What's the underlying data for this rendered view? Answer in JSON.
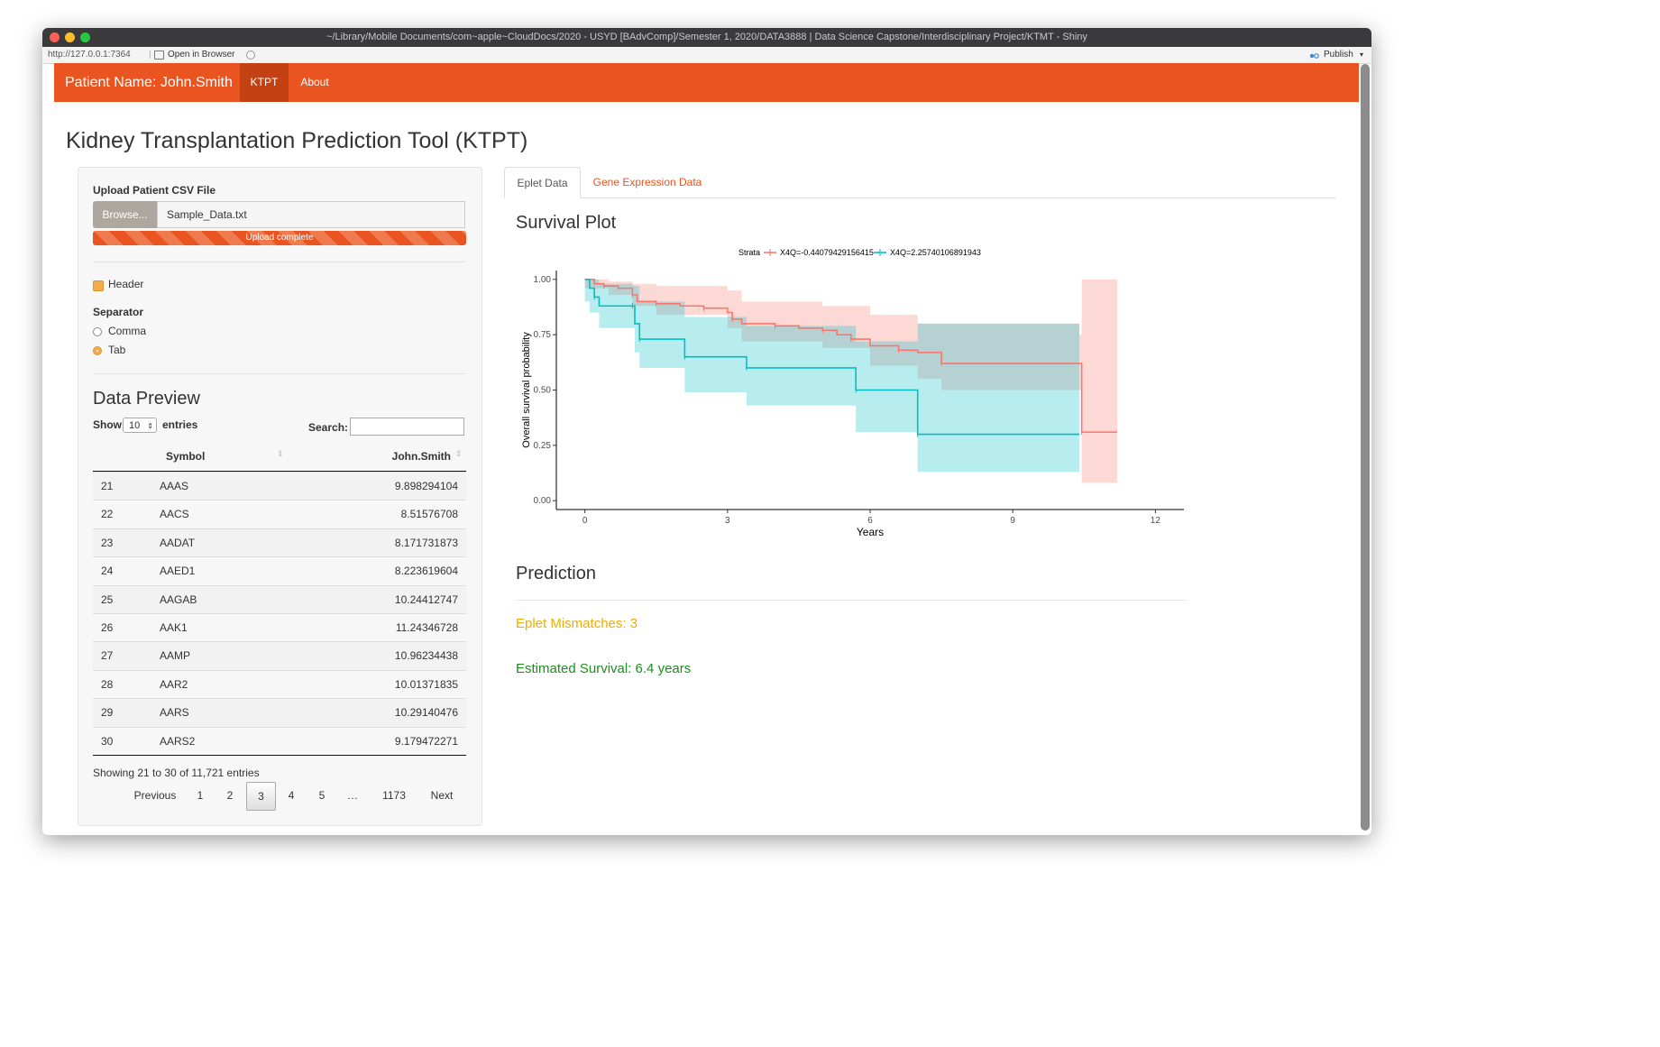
{
  "window": {
    "title": "~/Library/Mobile Documents/com~apple~CloudDocs/2020 - USYD [BAdvComp]/Semester 1, 2020/DATA3888 | Data Science Capstone/Interdisciplinary Project/KTMT - Shiny"
  },
  "toolbar": {
    "url": "http://127.0.0.1:7364",
    "open_in_browser": "Open in Browser",
    "publish": "Publish"
  },
  "nav": {
    "brand": "Patient Name: John.Smith",
    "tabs": [
      "KTPT",
      "About"
    ]
  },
  "page": {
    "title": "Kidney Transplantation Prediction Tool (KTPT)"
  },
  "sidebar": {
    "upload_label": "Upload Patient CSV File",
    "browse_label": "Browse...",
    "file_name": "Sample_Data.txt",
    "progress_text": "Upload complete",
    "upload_progress": 1.0,
    "header_label": "Header",
    "header_checked": true,
    "separator_label": "Separator",
    "separator_options": [
      "Comma",
      "Tab"
    ],
    "separator_selected": "Tab",
    "preview_title": "Data Preview",
    "show_label": "Show",
    "entries_value": "10",
    "entries_label": "entries",
    "search_label": "Search:",
    "columns": [
      "Symbol",
      "John.Smith"
    ],
    "rows": [
      {
        "idx": "21",
        "symbol": "AAAS",
        "value": "9.898294104"
      },
      {
        "idx": "22",
        "symbol": "AACS",
        "value": "8.51576708"
      },
      {
        "idx": "23",
        "symbol": "AADAT",
        "value": "8.171731873"
      },
      {
        "idx": "24",
        "symbol": "AAED1",
        "value": "8.223619604"
      },
      {
        "idx": "25",
        "symbol": "AAGAB",
        "value": "10.24412747"
      },
      {
        "idx": "26",
        "symbol": "AAK1",
        "value": "11.24346728"
      },
      {
        "idx": "27",
        "symbol": "AAMP",
        "value": "10.96234438"
      },
      {
        "idx": "28",
        "symbol": "AAR2",
        "value": "10.01371835"
      },
      {
        "idx": "29",
        "symbol": "AARS",
        "value": "10.29140476"
      },
      {
        "idx": "30",
        "symbol": "AARS2",
        "value": "9.179472271"
      }
    ],
    "info": "Showing 21 to 30 of 11,721 entries",
    "pagination": [
      "Previous",
      "1",
      "2",
      "3",
      "4",
      "5",
      "…",
      "1173",
      "Next"
    ],
    "current_page": "3"
  },
  "main": {
    "tabs": [
      "Eplet Data",
      "Gene Expression Data"
    ],
    "active_tab": "Eplet Data",
    "plot_title": "Survival Plot",
    "prediction_title": "Prediction",
    "eplet_mismatches": "Eplet Mismatches: 3",
    "estimated_survival": "Estimated Survival: 6.4 years"
  },
  "colors": {
    "brand_orange": "#e95420",
    "brand_dark": "#c34113",
    "series_red": "#f8766d",
    "series_teal": "#00bfc4",
    "warning": "#f0ad00",
    "success": "#1e8c1e"
  },
  "chart_data": {
    "type": "line",
    "xlabel": "Years",
    "ylabel": "Overall survival probability",
    "xlim": [
      -0.6,
      12.6
    ],
    "ylim": [
      -0.04,
      1.04
    ],
    "xticks": [
      0,
      3,
      6,
      9,
      12
    ],
    "yticks": [
      0.0,
      0.25,
      0.5,
      0.75,
      1.0
    ],
    "ytick_labels": [
      "0.00",
      "0.25",
      "0.50",
      "0.75",
      "1.00"
    ],
    "legend_title": "Strata",
    "legend_position": "top",
    "grid": false,
    "series": [
      {
        "name": "X4Q=-0.44079429156415",
        "color": "#f8766d",
        "steps": [
          [
            0,
            1.0
          ],
          [
            0.2,
            0.98
          ],
          [
            0.4,
            0.97
          ],
          [
            0.7,
            0.96
          ],
          [
            1.0,
            0.93
          ],
          [
            1.1,
            0.9
          ],
          [
            1.5,
            0.89
          ],
          [
            2.0,
            0.88
          ],
          [
            2.5,
            0.87
          ],
          [
            3.0,
            0.85
          ],
          [
            3.1,
            0.82
          ],
          [
            3.3,
            0.8
          ],
          [
            4.0,
            0.79
          ],
          [
            4.5,
            0.78
          ],
          [
            5.0,
            0.77
          ],
          [
            5.3,
            0.75
          ],
          [
            5.6,
            0.73
          ],
          [
            6.0,
            0.7
          ],
          [
            6.6,
            0.68
          ],
          [
            7.0,
            0.67
          ],
          [
            7.5,
            0.62
          ],
          [
            10.4,
            0.62
          ],
          [
            10.45,
            0.31
          ],
          [
            11.2,
            0.31
          ]
        ],
        "ci_upper": [
          [
            0,
            1.0
          ],
          [
            0.5,
            0.99
          ],
          [
            1.0,
            0.98
          ],
          [
            1.5,
            0.97
          ],
          [
            3.0,
            0.95
          ],
          [
            3.3,
            0.9
          ],
          [
            5.0,
            0.88
          ],
          [
            6.0,
            0.84
          ],
          [
            7.0,
            0.8
          ],
          [
            10.4,
            0.75
          ],
          [
            10.45,
            1.0
          ],
          [
            11.2,
            1.0
          ]
        ],
        "ci_lower": [
          [
            0,
            0.96
          ],
          [
            0.5,
            0.93
          ],
          [
            1.0,
            0.88
          ],
          [
            1.5,
            0.84
          ],
          [
            3.0,
            0.78
          ],
          [
            3.3,
            0.72
          ],
          [
            5.0,
            0.69
          ],
          [
            6.0,
            0.61
          ],
          [
            7.0,
            0.55
          ],
          [
            7.5,
            0.5
          ],
          [
            10.4,
            0.5
          ],
          [
            10.45,
            0.08
          ],
          [
            11.2,
            0.08
          ]
        ]
      },
      {
        "name": "X4Q=2.25740106891943",
        "color": "#00bfc4",
        "steps": [
          [
            0,
            1.0
          ],
          [
            0.1,
            0.96
          ],
          [
            0.2,
            0.92
          ],
          [
            0.3,
            0.88
          ],
          [
            1.0,
            0.88
          ],
          [
            1.05,
            0.8
          ],
          [
            1.15,
            0.73
          ],
          [
            2.0,
            0.73
          ],
          [
            2.1,
            0.65
          ],
          [
            3.3,
            0.65
          ],
          [
            3.4,
            0.6
          ],
          [
            5.6,
            0.6
          ],
          [
            5.7,
            0.5
          ],
          [
            6.9,
            0.5
          ],
          [
            7.0,
            0.3
          ],
          [
            10.4,
            0.3
          ]
        ],
        "ci_upper": [
          [
            0,
            1.0
          ],
          [
            0.3,
            0.98
          ],
          [
            1.0,
            0.97
          ],
          [
            1.15,
            0.9
          ],
          [
            2.1,
            0.83
          ],
          [
            3.4,
            0.79
          ],
          [
            5.7,
            0.72
          ],
          [
            7.0,
            0.8
          ],
          [
            10.4,
            0.8
          ]
        ],
        "ci_lower": [
          [
            0,
            0.9
          ],
          [
            0.1,
            0.85
          ],
          [
            0.3,
            0.78
          ],
          [
            1.05,
            0.67
          ],
          [
            1.15,
            0.6
          ],
          [
            2.1,
            0.49
          ],
          [
            3.4,
            0.43
          ],
          [
            5.7,
            0.31
          ],
          [
            7.0,
            0.13
          ],
          [
            10.4,
            0.13
          ]
        ]
      }
    ]
  }
}
